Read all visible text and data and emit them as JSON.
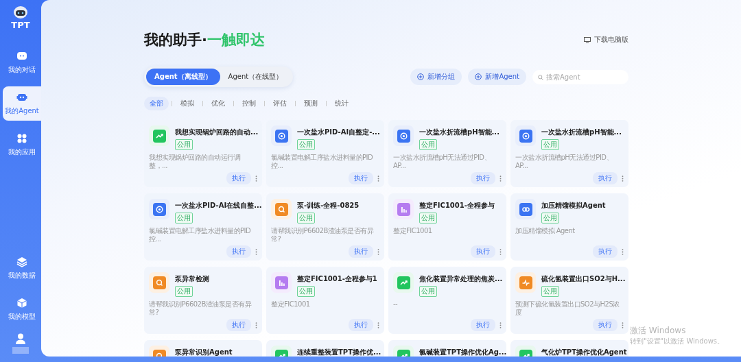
{
  "sidebar": {
    "logo": "TPT",
    "items": [
      {
        "label": "我的对话",
        "kind": "chat",
        "selected": false
      },
      {
        "label": "我的Agent",
        "kind": "robot",
        "selected": true
      },
      {
        "label": "我的应用",
        "kind": "apps",
        "selected": false
      },
      {
        "label": "我的数据",
        "kind": "layers",
        "selected": false
      },
      {
        "label": "我的模型",
        "kind": "cube",
        "selected": false
      }
    ]
  },
  "header": {
    "title": "我的助手·",
    "title_accent": "一触即达",
    "download": "下载电脑版"
  },
  "tabs": [
    {
      "label": "Agent（离线型）",
      "selected": true
    },
    {
      "label": "Agent（在线型）",
      "selected": false
    }
  ],
  "actions": [
    "新增分组",
    "新增Agent"
  ],
  "search": {
    "placeholder": "搜索Agent"
  },
  "filters": [
    {
      "label": "全部",
      "selected": true
    },
    {
      "label": "模拟",
      "selected": false
    },
    {
      "label": "优化",
      "selected": false
    },
    {
      "label": "控制",
      "selected": false
    },
    {
      "label": "评估",
      "selected": false
    },
    {
      "label": "预测",
      "selected": false
    },
    {
      "label": "统计",
      "selected": false
    }
  ],
  "cards": [
    {
      "kind": "chart",
      "title": "我想实现锅炉回路的自动...",
      "tag": "公用",
      "description": "我想实现锅炉回路的自动运行调整，...",
      "action": "执行"
    },
    {
      "kind": "cog",
      "title": "一次盐水PID-AI自整定-...",
      "tag": "公用",
      "description": "氯碱装置电解工序盐水进料量的PID控...",
      "action": "执行"
    },
    {
      "kind": "cog",
      "title": "一次盐水折流槽pH智能...",
      "tag": "公用",
      "description": "一次盐水折流槽pH无法通过PID、AP...",
      "action": "执行"
    },
    {
      "kind": "cog",
      "title": "一次盐水折流槽pH智能...",
      "tag": "公用",
      "description": "一次盐水折流槽pH无法通过PID、AP...",
      "action": "执行"
    },
    {
      "kind": "cog",
      "title": "一次盐水PID-AI在线自整...",
      "tag": "公用",
      "description": "氯碱装置电解工序盐水进料量的PID控...",
      "action": "执行"
    },
    {
      "kind": "search",
      "title": "泵-训练-全程-0825",
      "tag": "公用",
      "description": "请帮我识别P6602B渣油泵是否有异常?",
      "action": "执行"
    },
    {
      "kind": "bars",
      "title": "整定FIC1001-全程参与",
      "tag": "公用",
      "description": "整定FIC1001",
      "action": "执行"
    },
    {
      "kind": "link",
      "title": "加压精馏模拟Agent",
      "tag": "公用",
      "description": "加压精馏模拟 Agent",
      "action": "执行"
    },
    {
      "kind": "search",
      "title": "泵异常检测",
      "tag": "公用",
      "description": "请帮我识别P6602B渣油泵是否有异常?",
      "action": "执行"
    },
    {
      "kind": "bars",
      "title": "整定FIC1001-全程参与1",
      "tag": "公用",
      "description": "整定FIC1001",
      "action": "执行"
    },
    {
      "kind": "chart",
      "title": "焦化装置异常处理的焦炭...",
      "tag": "公用",
      "description": "--",
      "action": "执行"
    },
    {
      "kind": "pulse",
      "title": "硫化氢装置出口SO2与H...",
      "tag": "公用",
      "description": "预测下硫化氢装置出口SO2与H2S浓度",
      "action": "执行"
    },
    {
      "kind": "search",
      "title": "泵异常识别Agent"
    },
    {
      "kind": "chart",
      "title": "连续重整装置TPT操作优..."
    },
    {
      "kind": "chart",
      "title": "氯碱装置TPT操作优化Ag..."
    },
    {
      "kind": "chart",
      "title": "气化炉TPT操作优化Agent"
    }
  ],
  "os_watermark": {
    "title": "激活 Windows",
    "hint": "转到\"设置\"以激活 Windows。"
  }
}
